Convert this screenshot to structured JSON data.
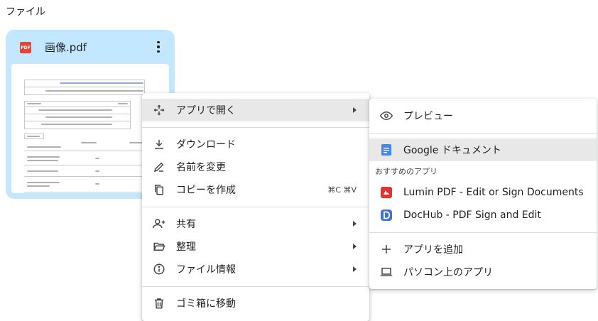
{
  "section": {
    "title": "ファイル"
  },
  "file_card": {
    "type_badge": "PDF",
    "name": "画像.pdf"
  },
  "context_menu": {
    "open_with": "アプリで開く",
    "download": "ダウンロード",
    "rename": "名前を変更",
    "make_copy": "コピーを作成",
    "make_copy_shortcut": "⌘C ⌘V",
    "share": "共有",
    "organize": "整理",
    "file_info": "ファイル情報",
    "move_to_trash": "ゴミ箱に移動"
  },
  "open_with_menu": {
    "preview": "プレビュー",
    "google_docs": "Google ドキュメント",
    "recommended_label": "おすすめのアプリ",
    "apps": [
      {
        "name": "Lumin PDF - Edit or Sign Documents"
      },
      {
        "name": "DocHub - PDF Sign and Edit"
      }
    ],
    "add_app": "アプリを追加",
    "computer_apps": "パソコン上のアプリ"
  },
  "colors": {
    "card_background": "#c2e7ff",
    "pdf_red": "#ea4335",
    "docs_blue": "#4285f4",
    "lumin_red": "#e3342f",
    "dochub_blue": "#3f74d6",
    "hover_gray": "#e8e8e8"
  }
}
